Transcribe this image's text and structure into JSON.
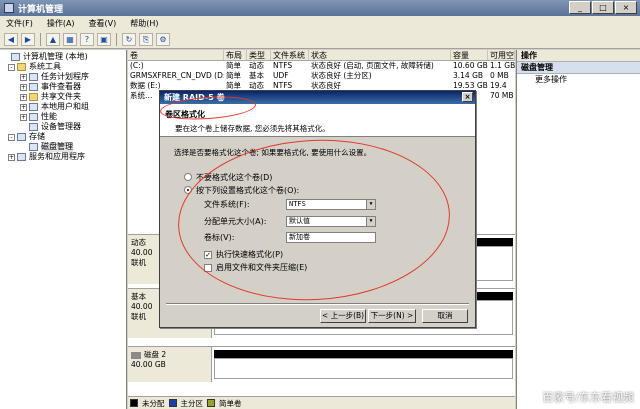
{
  "window": {
    "title": "计算机管理"
  },
  "menu": [
    "文件(F)",
    "操作(A)",
    "查看(V)",
    "帮助(H)"
  ],
  "toolbar_icons": [
    "back-icon",
    "forward-icon",
    "up-icon",
    "properties-icon",
    "help-icon",
    "console-icon",
    "refresh-icon",
    "export-icon",
    "settings-icon"
  ],
  "tree": [
    {
      "label": "计算机管理 (本地)",
      "level": 0,
      "expander": "",
      "icon": "computer-icon"
    },
    {
      "label": "系统工具",
      "level": 1,
      "expander": "-",
      "icon": "tools-icon"
    },
    {
      "label": "任务计划程序",
      "level": 2,
      "expander": "+",
      "icon": "clock-icon"
    },
    {
      "label": "事件查看器",
      "level": 2,
      "expander": "+",
      "icon": "event-icon"
    },
    {
      "label": "共享文件夹",
      "level": 2,
      "expander": "+",
      "icon": "folder-icon"
    },
    {
      "label": "本地用户和组",
      "level": 2,
      "expander": "+",
      "icon": "users-icon"
    },
    {
      "label": "性能",
      "level": 2,
      "expander": "+",
      "icon": "performance-icon"
    },
    {
      "label": "设备管理器",
      "level": 2,
      "expander": "",
      "icon": "device-icon"
    },
    {
      "label": "存储",
      "level": 1,
      "expander": "-",
      "icon": "storage-icon"
    },
    {
      "label": "磁盘管理",
      "level": 2,
      "expander": "",
      "icon": "disk-icon",
      "selected": true
    },
    {
      "label": "服务和应用程序",
      "level": 1,
      "expander": "+",
      "icon": "services-icon"
    }
  ],
  "volume_table": {
    "columns": [
      "卷",
      "布局",
      "类型",
      "文件系统",
      "状态",
      "容量",
      "可用空"
    ],
    "rows": [
      [
        "(C:)",
        "简单",
        "动态",
        "NTFS",
        "状态良好 (启动, 页面文件, 故障转储)",
        "10.60 GB",
        "1.1 GB"
      ],
      [
        "GRMSXFRER_CN_DVD (D:)",
        "简单",
        "基本",
        "UDF",
        "状态良好 (主分区)",
        "3.14 GB",
        "0 MB"
      ],
      [
        "数据 (E:)",
        "简单",
        "动态",
        "NTFS",
        "状态良好",
        "19.53 GB",
        "19.4"
      ],
      [
        "系统…",
        "",
        "",
        "",
        "",
        "",
        "70 MB"
      ]
    ]
  },
  "disks": [
    {
      "name": "动态",
      "size": "40.00",
      "status": "联机"
    },
    {
      "name": "基本",
      "size": "40.00",
      "status": "联机"
    },
    {
      "name": "磁盘 2",
      "size": "40.00 GB",
      "status": ""
    }
  ],
  "legend": [
    {
      "label": "未分配",
      "color": "#000000"
    },
    {
      "label": "主分区",
      "color": "#1f3fa8"
    },
    {
      "label": "简单卷",
      "color": "#9aa32a"
    }
  ],
  "actions": {
    "header": "操作",
    "section": "磁盘管理",
    "more": "更多操作"
  },
  "dialog": {
    "title": "新建 RAID-5 卷",
    "heading": "卷区格式化",
    "subheading": "要在这个卷上储存数据, 您必须先将其格式化。",
    "prompt": "选择是否要格式化这个卷; 如果要格式化, 要使用什么设置。",
    "radio_no_format": "不要格式化这个卷(D)",
    "radio_format": "按下列设置格式化这个卷(O):",
    "fs_label": "文件系统(F):",
    "fs_value": "NTFS",
    "alloc_label": "分配单元大小(A):",
    "alloc_value": "默认值",
    "volume_label": "卷标(V):",
    "volume_value": "新加卷",
    "quick_format": "执行快速格式化(P)",
    "compression": "启用文件和文件夹压缩(E)",
    "back_button": "< 上一步(B)",
    "next_button": "下一步(N) >",
    "cancel_button": "取消"
  },
  "watermark": "百家号/东东看视频"
}
